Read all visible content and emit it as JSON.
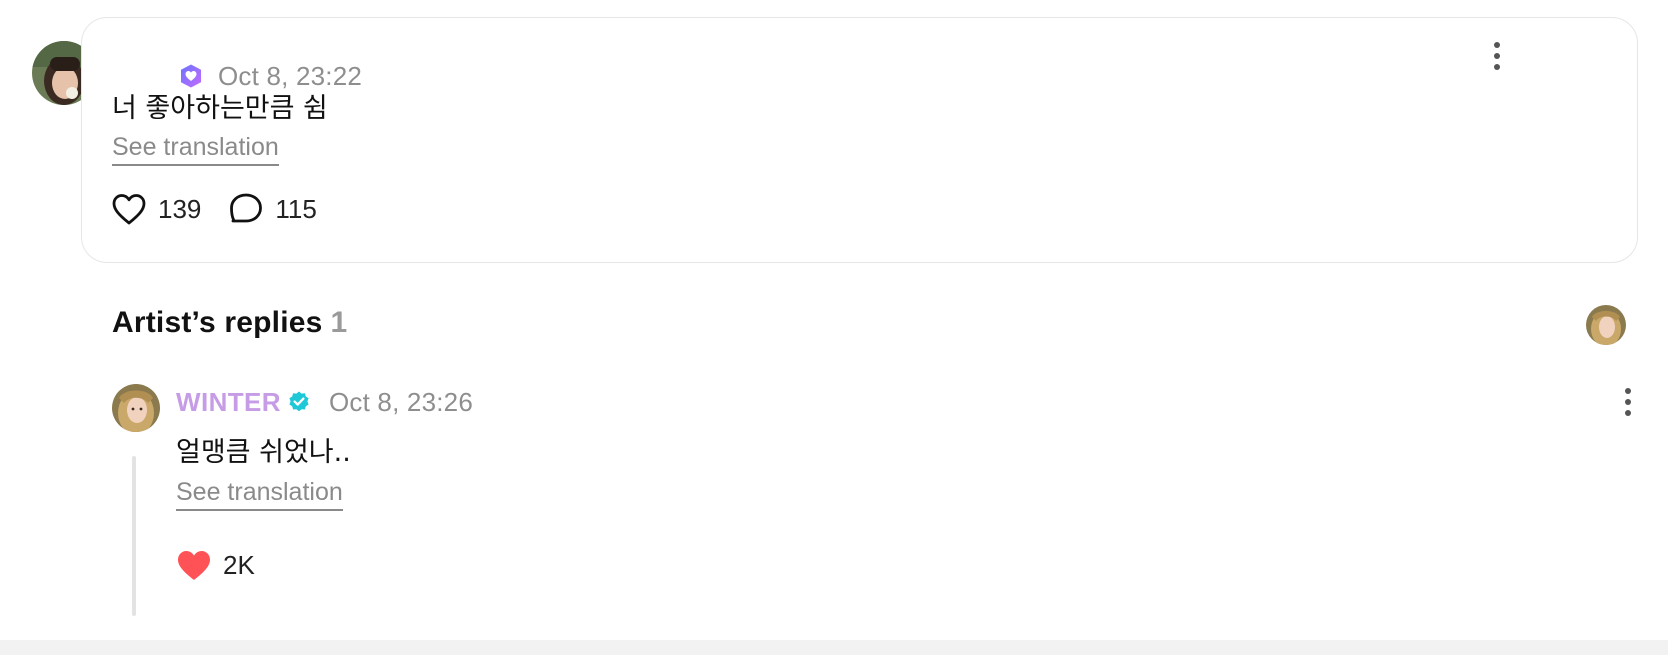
{
  "post": {
    "timestamp": "Oct 8, 23:22",
    "text": "너 좋아하는만큼 쉼",
    "see_translation": "See translation",
    "likes": "139",
    "comments": "115"
  },
  "artist_replies": {
    "title": "Artist’s replies",
    "count": "1"
  },
  "reply": {
    "author": "WINTER",
    "timestamp": "Oct 8, 23:26",
    "text": "얼맹큼 쉬었나..",
    "see_translation": "See translation",
    "likes": "2K"
  },
  "colors": {
    "artist_name": "#c69ce6",
    "verified": "#1ec8d6",
    "liked_heart": "#ff5257",
    "fan_badge_start": "#6b74ff",
    "fan_badge_end": "#c46bff"
  },
  "icons": {
    "fan_badge": "fan-heart-shield-icon",
    "more": "vertical-dots-icon",
    "like": "heart-outline-icon",
    "comment": "speech-bubble-icon",
    "verified": "verified-check-icon",
    "liked": "heart-filled-icon"
  }
}
